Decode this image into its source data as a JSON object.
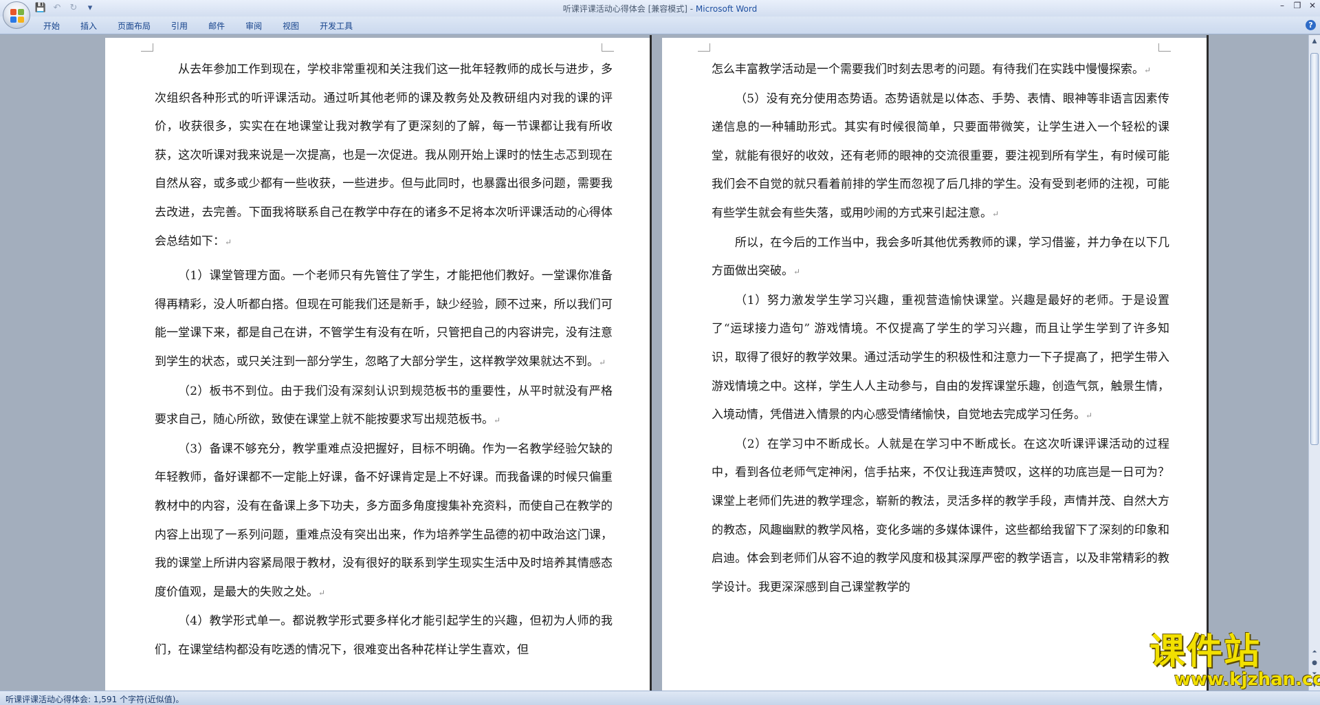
{
  "window": {
    "title_doc": "听课评课活动心得体会 [兼容模式] - ",
    "title_app": "Microsoft Word"
  },
  "qat": {
    "save": "💾",
    "undo": "↶",
    "redo": "↻",
    "customize": "▾"
  },
  "ribbon_tabs": [
    "开始",
    "插入",
    "页面布局",
    "引用",
    "邮件",
    "审阅",
    "视图",
    "开发工具"
  ],
  "page1": {
    "paragraphs": [
      "从去年参加工作到现在，学校非常重视和关注我们这一批年轻教师的成长与进步，多次组织各种形式的听评课活动。通过听其他老师的课及教务处及教研组内对我的课的评价，收获很多，实实在在地课堂让我对教学有了更深刻的了解，每一节课都让我有所收获，这次听课对我来说是一次提高，也是一次促进。我从刚开始上课时的怯生忐忑到现在自然从容，或多或少都有一些收获，一些进步。但与此同时，也暴露出很多问题，需要我去改进，去完善。下面我将联系自己在教学中存在的诸多不足将本次听评课活动的心得体会总结如下：",
      "（1）课堂管理方面。一个老师只有先管住了学生，才能把他们教好。一堂课你准备得再精彩，没人听都白搭。但现在可能我们还是新手，缺少经验，顾不过来，所以我们可能一堂课下来，都是自己在讲，不管学生有没有在听，只管把自己的内容讲完，没有注意到学生的状态，或只关注到一部分学生，忽略了大部分学生，这样教学效果就达不到。",
      "（2）板书不到位。由于我们没有深刻认识到规范板书的重要性，从平时就没有严格要求自己，随心所欲，致使在课堂上就不能按要求写出规范板书。",
      "（3）备课不够充分，教学重难点没把握好，目标不明确。作为一名教学经验欠缺的年轻教师，备好课都不一定能上好课，备不好课肯定是上不好课。而我备课的时候只偏重教材中的内容，没有在备课上多下功夫，多方面多角度搜集补充资料，而使自己在教学的内容上出现了一系列问题，重难点没有突出出来，作为培养学生品德的初中政治这门课，我的课堂上所讲内容紧局限于教材，没有很好的联系到学生现实生活中及时培养其情感态度价值观，是最大的失败之处。",
      "（4）教学形式单一。都说教学形式要多样化才能引起学生的兴趣，但初为人师的我们，在课堂结构都没有吃透的情况下，很难变出各种花样让学生喜欢，但"
    ]
  },
  "page2": {
    "paragraphs": [
      "怎么丰富教学活动是一个需要我们时刻去思考的问题。有待我们在实践中慢慢探索。",
      "（5）没有充分使用态势语。态势语就是以体态、手势、表情、眼神等非语言因素传递信息的一种辅助形式。其实有时候很简单，只要面带微笑，让学生进入一个轻松的课堂，就能有很好的收效，还有老师的眼神的交流很重要，要注视到所有学生，有时候可能我们会不自觉的就只看着前排的学生而忽视了后几排的学生。没有受到老师的注视，可能有些学生就会有些失落，或用吵闹的方式来引起注意。",
      "所以，在今后的工作当中，我会多听其他优秀教师的课，学习借鉴，并力争在以下几方面做出突破。",
      "（1）努力激发学生学习兴趣，重视营造愉快课堂。兴趣是最好的老师。于是设置了“运球接力造句” 游戏情境。不仅提高了学生的学习兴趣，而且让学生学到了许多知识，取得了很好的教学效果。通过活动学生的积极性和注意力一下子提高了，把学生带入游戏情境之中。这样，学生人人主动参与，自由的发挥课堂乐趣，创造气氛，触景生情，入境动情，凭借进入情景的内心感受情绪愉快，自觉地去完成学习任务。",
      "（2）在学习中不断成长。人就是在学习中不断成长。在这次听课评课活动的过程中，看到各位老师气定神闲，信手拈来，不仅让我连声赞叹，这样的功底岂是一日可为？课堂上老师们先进的教学理念，崭新的教法，灵活多样的教学手段，声情并茂、自然大方的教态，风趣幽默的教学风格，变化多端的多媒体课件，这些都给我留下了深刻的印象和启迪。体会到老师们从容不迫的教学风度和极其深厚严密的教学语言，以及非常精彩的教学设计。我更深深感到自己课堂教学的"
    ]
  },
  "paragraph_mark": "↵",
  "statusbar": {
    "text": "听课评课活动心得体会: 1,591 个字符(近似值)。"
  },
  "watermark": {
    "main": "课件站",
    "url": "www.kjzhan.com"
  }
}
